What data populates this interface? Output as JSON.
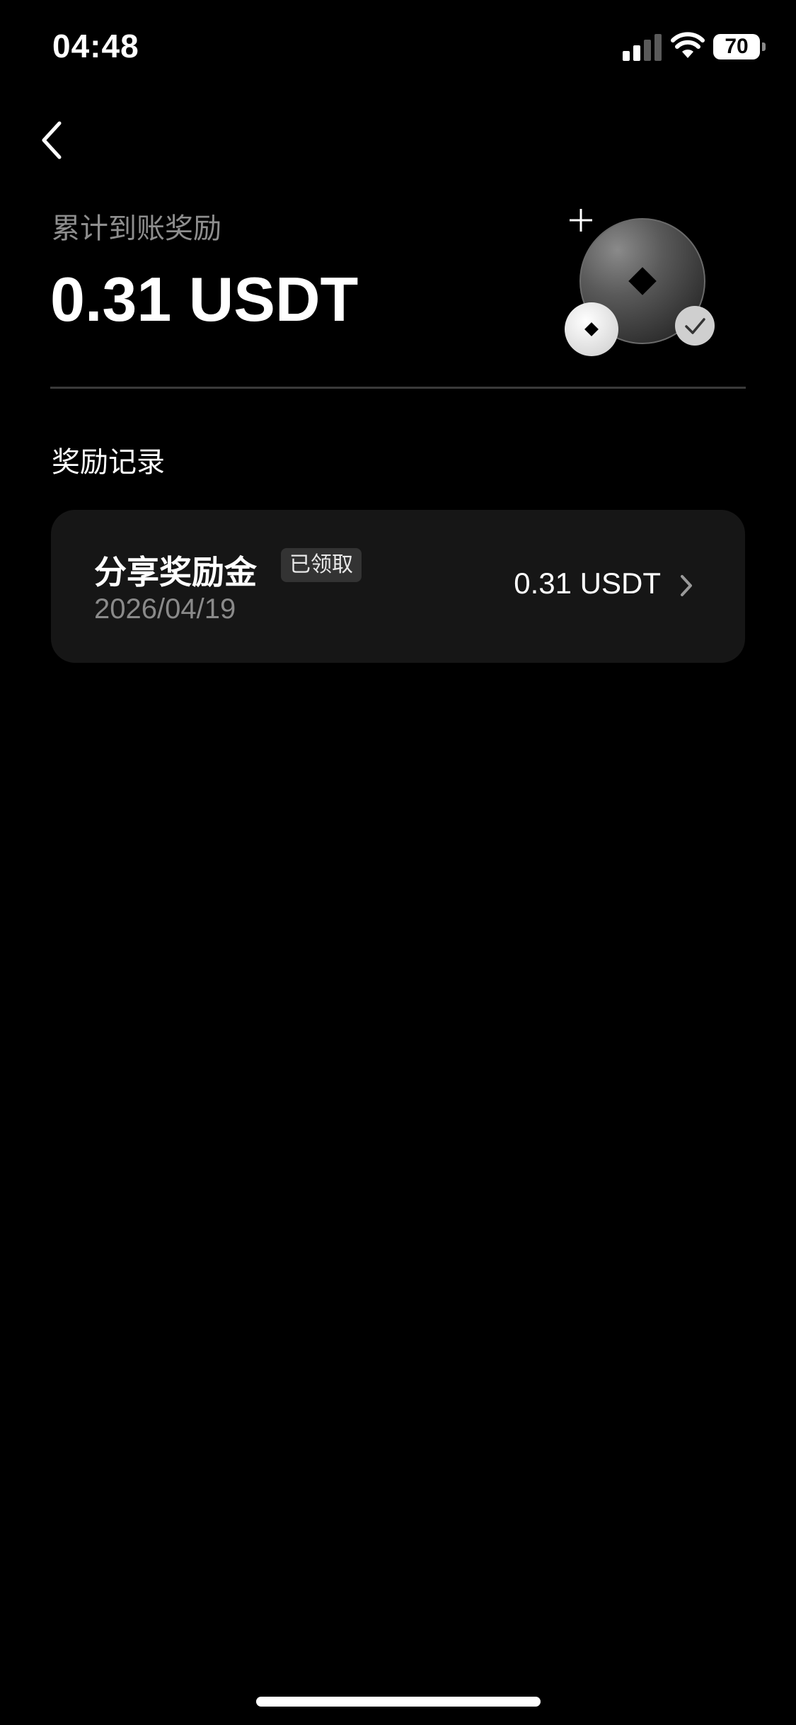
{
  "status_bar": {
    "time": "04:48",
    "battery_level": "70"
  },
  "summary": {
    "label": "累计到账奖励",
    "amount": "0.31 USDT"
  },
  "records": {
    "title": "奖励记录",
    "items": [
      {
        "name": "分享奖励金",
        "status": "已领取",
        "date": "2026/04/19",
        "amount": "0.31 USDT"
      }
    ]
  },
  "icons": {
    "back": "chevron-left-icon",
    "item_arrow": "chevron-right-icon",
    "illustration": "coins-illustration"
  },
  "colors": {
    "background": "#000000",
    "card": "#161616",
    "muted_text": "#8e8e8e",
    "badge": "#333333"
  }
}
